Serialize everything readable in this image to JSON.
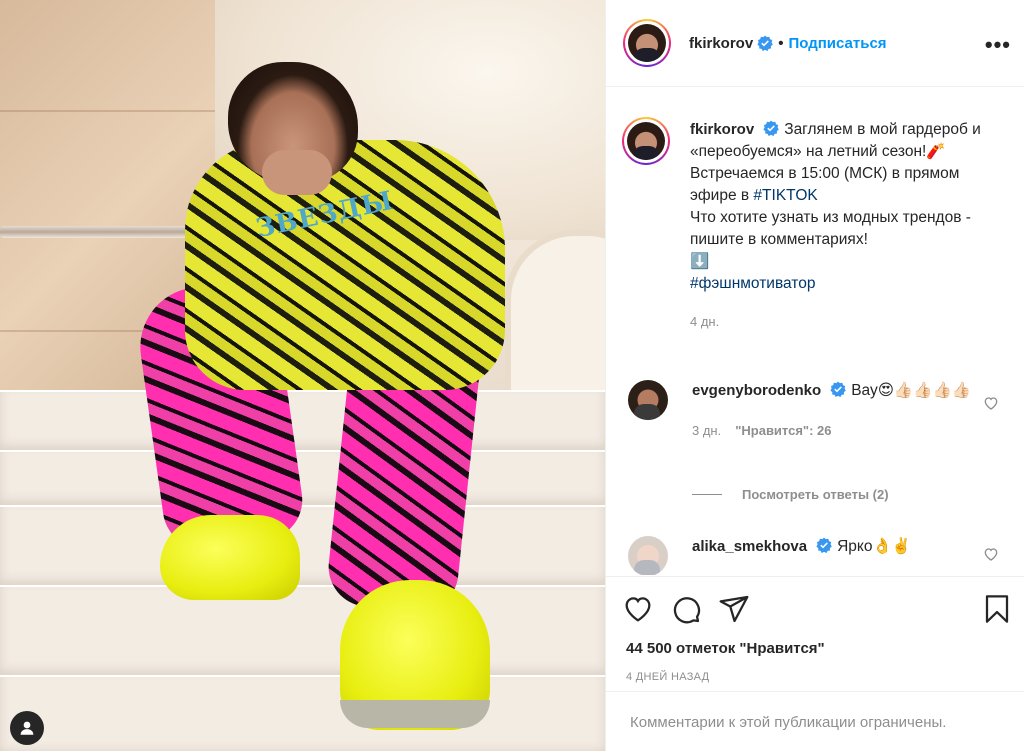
{
  "post": {
    "author": "fkirkorov",
    "separator": "•",
    "follow_label": "Подписаться",
    "more_label": "•••",
    "photo_print": "ЗВЕЗДЫ"
  },
  "caption": {
    "username": "fkirkorov",
    "lines": [
      "Заглянем в мой гардероб и «переобуемся» на летний сезон!🧨",
      "Встречаемся в 15:00 (МСК) в прямом эфире в ",
      "Что хотите узнать из модных трендов - пишите в комментариях!",
      "⬇️"
    ],
    "hashtag_tiktok": "#TIKTOK",
    "hashtag": "#фэшнмотиватор",
    "time": "4 дн."
  },
  "comments": [
    {
      "username": "evgenyborodenko",
      "text": "Вау😍👍🏻👍🏻👍🏻👍🏻",
      "time": "3 дн.",
      "likes": "\"Нравится\": 26",
      "replies_label": "Посмотреть ответы (2)"
    },
    {
      "username": "alika_smekhova",
      "text": "Ярко👌✌️"
    }
  ],
  "footer": {
    "likes_count": "44 500 отметок \"Нравится\"",
    "posted_ago": "4 ДНЕЙ НАЗАД",
    "comments_limited": "Комментарии к этой публикации ограничены."
  },
  "colors": {
    "accent": "#0095f6",
    "verified": "#3897f0",
    "secondary_text": "#8e8e8e",
    "hashtag": "#00376b"
  },
  "icons": [
    "heart-icon",
    "comment-icon",
    "share-icon",
    "bookmark-icon",
    "verified-icon",
    "more-icon",
    "user-tag-icon"
  ]
}
